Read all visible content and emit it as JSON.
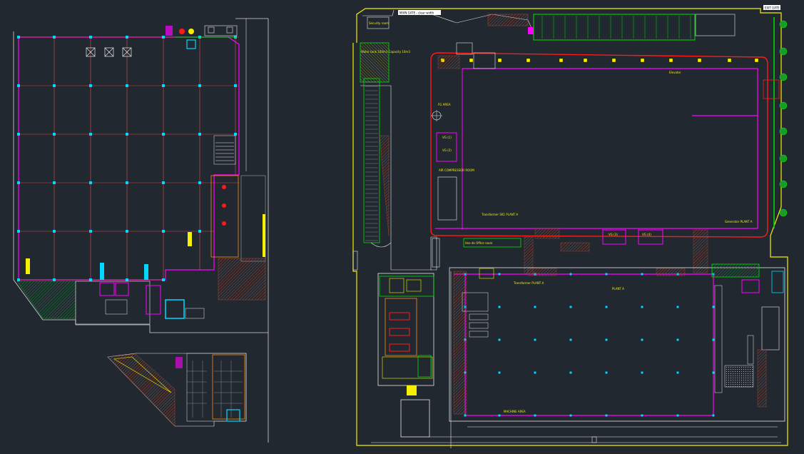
{
  "labels": {
    "main_gate": "MAIN GATE - clear width",
    "exit_gate": "EXIT GATE",
    "security_room": "Security room",
    "fg_area": "FG AREA",
    "elevator": "Elevator",
    "hse_office": "Hse de Office room",
    "vg_1": "VG (1)",
    "vg_2": "VG (2)",
    "vg_3": "VG (3)",
    "vg_4": "VG (4)",
    "air_compressor": "AIR COMPRESSOR ROOM",
    "transformer_1": "Transformer SK1 PLANT A",
    "transformer_2": "Transformer PLANT A",
    "generator": "Generator PLANT A",
    "block_label": "PLANT A",
    "machine_label": "MACHINE AREA",
    "water_tank": "Water tank 100m3 Capacity 10m3"
  },
  "colors": {
    "background": "#212830",
    "wall_magenta": "#ff00ff",
    "column_cyan": "#00d8ff",
    "grid_red": "#e04848",
    "boundary_yellow": "#f4f000",
    "green": "#00e000",
    "white": "#e8e8e8",
    "grey": "#9aa0a6",
    "red": "#ff1a1a",
    "orange": "#ff8a1a",
    "hatch": "#8a3a30"
  }
}
